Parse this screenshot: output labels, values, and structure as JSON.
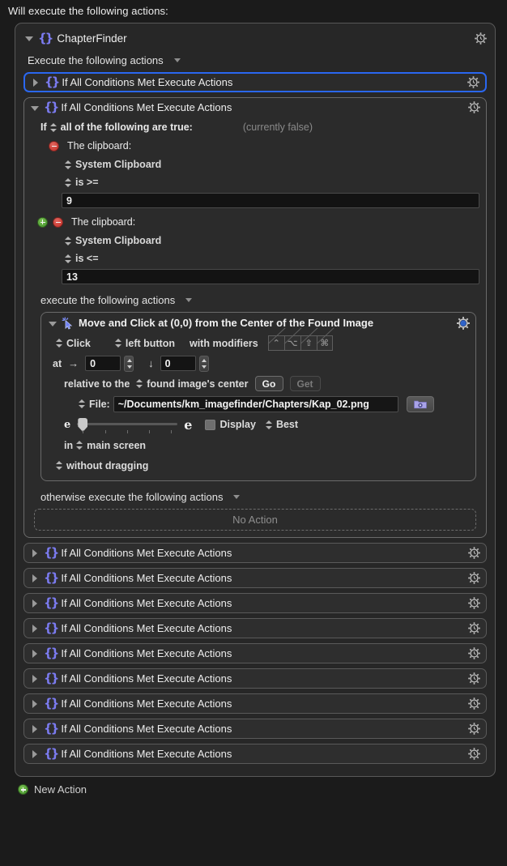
{
  "header": {
    "title": "Will execute the following actions:"
  },
  "macro": {
    "name": "ChapterFinder",
    "execute_label": "Execute the following actions",
    "gear_icon": "gear-clock-icon",
    "braces_icon": "braces-icon"
  },
  "selected_action": {
    "title": "If All Conditions Met Execute Actions"
  },
  "expanded_if": {
    "title": "If All Conditions Met Execute Actions",
    "if_label": "If",
    "match_mode": "all of the following are true:",
    "status": "(currently false)",
    "conditions": [
      {
        "title": "The clipboard:",
        "source": "System Clipboard",
        "operator": "is >=",
        "value": "9",
        "has_add": false,
        "has_remove": true
      },
      {
        "title": "The clipboard:",
        "source": "System Clipboard",
        "operator": "is <=",
        "value": "13",
        "has_add": true,
        "has_remove": true
      }
    ],
    "then_label": "execute the following actions",
    "else_label": "otherwise execute the following actions",
    "no_action_label": "No Action"
  },
  "move_click": {
    "title": "Move and Click at (0,0) from the Center of the Found Image",
    "icon": "click-cursor-icon",
    "gear_icon": "gear-blue-icon",
    "action_verb": "Click",
    "button": "left button",
    "modifiers_label": "with modifiers",
    "modifier_keys": [
      "⌃",
      "⌥",
      "⇧",
      "⌘"
    ],
    "at_label": "at",
    "x_arrow": "→",
    "x_value": "0",
    "y_arrow": "↓",
    "y_value": "0",
    "relative_label": "relative to the",
    "relative_target": "found image's center",
    "go_label": "Go",
    "get_label": "Get",
    "file_label": "File:",
    "file_path": "~/Documents/km_imagefinder/Chapters/Kap_02.png",
    "folder_icon": "folder-gear-icon",
    "fuzz_min_label": "e",
    "fuzz_max_label": "e",
    "display_label": "Display",
    "display_checked": false,
    "quality": "Best",
    "screen_prefix": "in",
    "screen_value": "main screen",
    "drag_mode": "without dragging"
  },
  "collapsed_actions": [
    {
      "title": "If All Conditions Met Execute Actions"
    },
    {
      "title": "If All Conditions Met Execute Actions"
    },
    {
      "title": "If All Conditions Met Execute Actions"
    },
    {
      "title": "If All Conditions Met Execute Actions"
    },
    {
      "title": "If All Conditions Met Execute Actions"
    },
    {
      "title": "If All Conditions Met Execute Actions"
    },
    {
      "title": "If All Conditions Met Execute Actions"
    },
    {
      "title": "If All Conditions Met Execute Actions"
    },
    {
      "title": "If All Conditions Met Execute Actions"
    }
  ],
  "footer": {
    "new_action_label": "New Action"
  },
  "colors": {
    "accent_blue": "#2a67f0",
    "braces_purple": "#7b7bf0",
    "add_green": "#3d8e28",
    "remove_red": "#c32a23",
    "panel_bg": "#272727",
    "window_bg": "#1b1b1b"
  }
}
